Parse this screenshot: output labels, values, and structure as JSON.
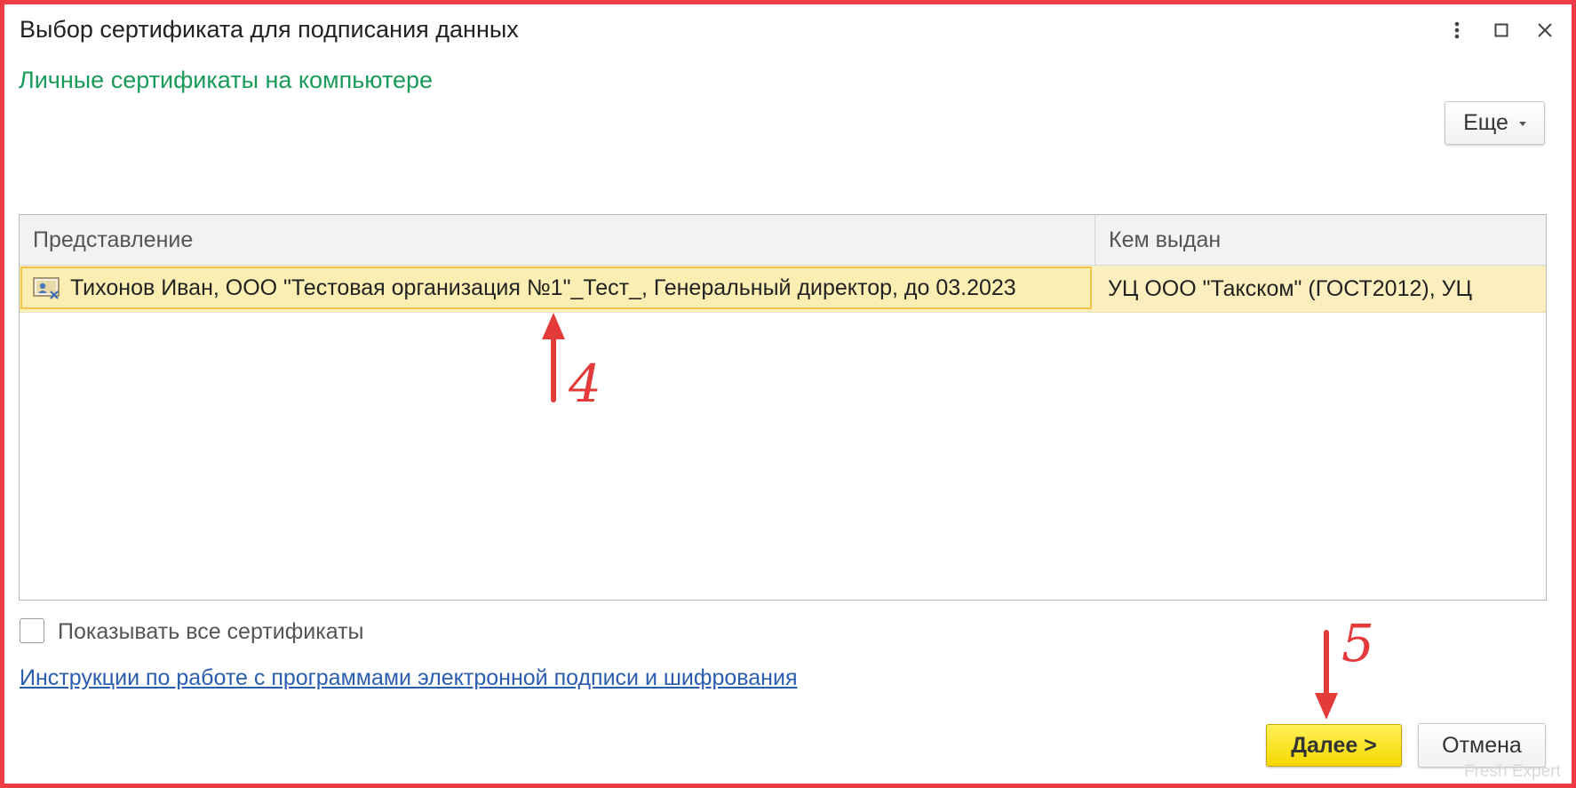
{
  "window": {
    "title": "Выбор сертификата для подписания данных",
    "subtitle": "Личные сертификаты на компьютере",
    "more_label": "Еще"
  },
  "table": {
    "columns": [
      "Представление",
      "Кем выдан"
    ],
    "rows": [
      {
        "presentation": "Тихонов Иван, ООО \"Тестовая организация №1\"_Тест_, Генеральный директор, до 03.2023",
        "issuer": "УЦ ООО \"Такском\" (ГОСТ2012), УЦ"
      }
    ]
  },
  "show_all": {
    "label": "Показывать все сертификаты",
    "checked": false
  },
  "instructions_link": "Инструкции по работе с программами электронной подписи и шифрования",
  "buttons": {
    "next": "Далее >",
    "cancel": "Отмена"
  },
  "annotations": {
    "step4": "4",
    "step5": "5"
  },
  "watermark": "Fresh Expert",
  "colors": {
    "accent_green": "#1a9b5a",
    "selected_row": "#fbf0bd",
    "primary_button": "#f7d800",
    "annotation_red": "#e43a3a"
  }
}
